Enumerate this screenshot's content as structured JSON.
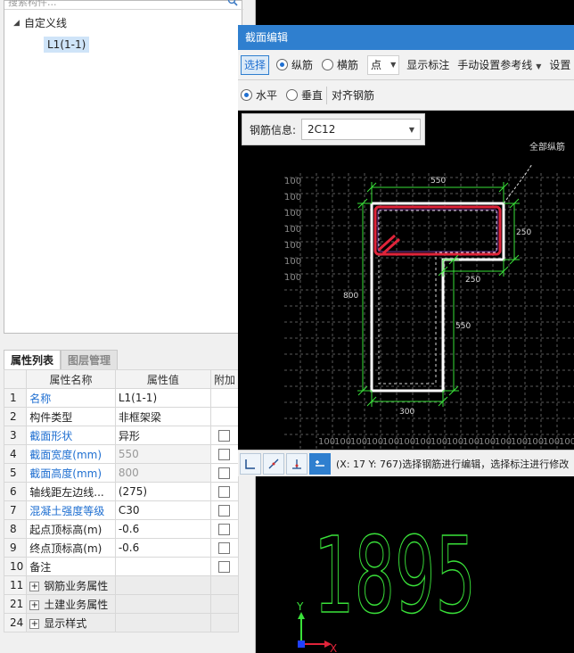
{
  "tree": {
    "search_placeholder": "搜索构件...",
    "root_label": "自定义线",
    "child_label": "L1(1-1)"
  },
  "tabs": {
    "properties": "属性列表",
    "layers": "图层管理"
  },
  "grid": {
    "headers": [
      "属性名称",
      "属性值",
      "附加"
    ],
    "rows": [
      {
        "num": "1",
        "name": "名称",
        "value": "L1(1-1)",
        "blue": true,
        "check": false,
        "gray": false
      },
      {
        "num": "2",
        "name": "构件类型",
        "value": "非框架梁",
        "blue": false,
        "check": false,
        "gray": false
      },
      {
        "num": "3",
        "name": "截面形状",
        "value": "异形",
        "blue": true,
        "check": true,
        "gray": false
      },
      {
        "num": "4",
        "name": "截面宽度(mm)",
        "value": "550",
        "blue": true,
        "check": true,
        "gray": true
      },
      {
        "num": "5",
        "name": "截面高度(mm)",
        "value": "800",
        "blue": true,
        "check": true,
        "gray": true
      },
      {
        "num": "6",
        "name": "轴线距左边线...",
        "value": "(275)",
        "blue": false,
        "check": true,
        "gray": false
      },
      {
        "num": "7",
        "name": "混凝土强度等级",
        "value": "C30",
        "blue": true,
        "check": true,
        "gray": false
      },
      {
        "num": "8",
        "name": "起点顶标高(m)",
        "value": "-0.6",
        "blue": false,
        "check": true,
        "gray": false
      },
      {
        "num": "9",
        "name": "终点顶标高(m)",
        "value": "-0.6",
        "blue": false,
        "check": true,
        "gray": false
      },
      {
        "num": "10",
        "name": "备注",
        "value": "",
        "blue": false,
        "check": true,
        "gray": false
      }
    ],
    "groups": [
      {
        "num": "11",
        "name": "钢筋业务属性"
      },
      {
        "num": "21",
        "name": "土建业务属性"
      },
      {
        "num": "24",
        "name": "显示样式"
      }
    ]
  },
  "dialog": {
    "title": "截面编辑",
    "toolbar1": {
      "select": "选择",
      "longitudinal": "纵筋",
      "stirrup": "横筋",
      "point": "点",
      "show_dims": "显示标注",
      "manual_ref": "手动设置参考线",
      "settings": "设置"
    },
    "toolbar2": {
      "horizontal": "水平",
      "vertical": "垂直",
      "align": "对齐钢筋"
    },
    "rebar_info_label": "钢筋信息:",
    "rebar_info_value": "2C12",
    "canvas": {
      "callout": "全部纵筋",
      "dims": {
        "top": "550",
        "right_flange": "250",
        "step": "250",
        "left": "800",
        "web": "550",
        "bottom": "300"
      },
      "grid_label": "100"
    },
    "status_text": "(X: 17 Y: 767)选择钢筋进行编辑，选择标注进行修改"
  },
  "viewport": {
    "number": "1895",
    "axis_y": "Y",
    "axis_x": "X"
  },
  "colors": {
    "title_blue": "#2f7fcf",
    "dim_green": "#39e039",
    "rebar_red": "#e0243a",
    "section_white": "#ffffff"
  }
}
